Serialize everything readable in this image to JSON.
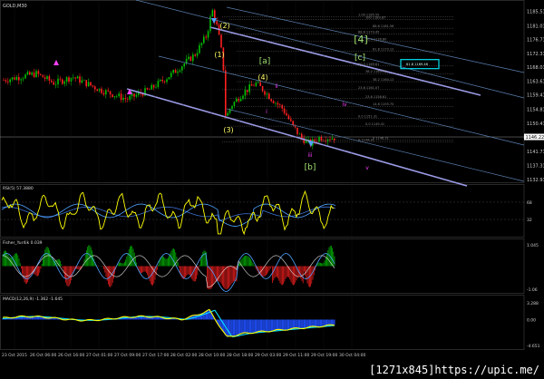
{
  "watermark": "[1271x845]https://upic.me/",
  "colors": {
    "background": "#000000",
    "bull_candle": "#00c000",
    "bear_candle": "#ff2020",
    "channel_main": "#9a9ae6",
    "channel_thin": "#5a7fb0",
    "wave_label": "#ffff66",
    "abc_label": "#a0e070",
    "sub_label": "#ff40ff",
    "rsi_line": "#ffff00",
    "ma_line": "#4fa3ff",
    "fisher_pos": "#00c000",
    "fisher_neg": "#ff2020",
    "macd_hist": "#2050ff",
    "macd_signal": "#00e0ff",
    "grid": "#1e3a1e"
  },
  "main": {
    "title": "GOLD,M30",
    "price_labels": [
      "1185.51",
      "1181.01",
      "1176.71",
      "1172.31",
      "1168.01",
      "1163.61",
      "1159.41",
      "1154.81",
      "1150.41",
      "1146.22",
      "1141.71",
      "1137.31",
      "1132.91"
    ],
    "current_price": "1146.22",
    "wave_labels": [
      "(2)",
      "(1)",
      "(4)",
      "(3)",
      "[a]",
      "[4]",
      "[c]",
      "[b]",
      "i",
      "ii",
      "iii",
      "iv",
      "v"
    ],
    "fib_levels": [
      {
        "label": "1.00 1185.55",
        "y": 1183.8
      },
      {
        "label": "100 1183.87",
        "y": 1183.0
      },
      {
        "label": "88.6 1181.56",
        "y": 1180.2
      },
      {
        "label": "88.6 1179.45",
        "y": 1178.4
      },
      {
        "label": "76.4 1176.80",
        "y": 1176.2
      },
      {
        "label": "61.8 1173.12",
        "y": 1173.0
      },
      {
        "label": "50.0 1169.61",
        "y": 1168.4
      },
      {
        "label": "38.2 1165.98",
        "y": 1166.0
      },
      {
        "label": "38.2 1164.12",
        "y": 1163.5
      },
      {
        "label": "23.6 1161.07",
        "y": 1161.0
      },
      {
        "label": "23.6 1158.61",
        "y": 1158.2
      },
      {
        "label": "14.6 1155.70",
        "y": 1155.8
      },
      {
        "label": "0.0 1151.31",
        "y": 1152.0
      },
      {
        "label": "0.0 1149.41",
        "y": 1149.6
      },
      {
        "label": "0 1146.31",
        "y": 1145.2
      },
      {
        "label": "0 1144.31",
        "y": 1144.6
      }
    ],
    "highlight_level": "61.8 1169.46"
  },
  "time_labels": [
    "23 Oct 2015",
    "26 Oct 06:00",
    "26 Oct 16:00",
    "27 Oct 01:00",
    "27 Oct 09:00",
    "27 Oct 17:00",
    "28 Oct 02:00",
    "28 Oct 10:00",
    "28 Oct 18:00",
    "29 Oct 03:00",
    "29 Oct 11:00",
    "29 Oct 19:00",
    "30 Oct 04:00"
  ],
  "rsi": {
    "title": "RSI(5) 57.3880",
    "levels": [
      "68",
      "32"
    ]
  },
  "fisher": {
    "title": "Fisher_Yur4ik 0.039",
    "levels": [
      "1.045",
      "-1.06"
    ]
  },
  "macd": {
    "title": "MACD(12,26,9) -1.362 -1.645",
    "levels": [
      "3.288",
      "0.00",
      "-4.651"
    ]
  },
  "chart_data": [
    {
      "type": "line",
      "title": "GOLD,M30",
      "note": "price path of candlestick series (approximate closes)",
      "x": [
        "23 Oct 2015",
        "26 Oct 06:00",
        "26 Oct 16:00",
        "27 Oct 01:00",
        "27 Oct 09:00",
        "27 Oct 17:00",
        "28 Oct 02:00",
        "28 Oct 10:00",
        "28 Oct 18:00",
        "29 Oct 03:00",
        "29 Oct 11:00",
        "29 Oct 19:00",
        "30 Oct 04:00"
      ],
      "series": [
        {
          "values": [
            1164,
            1165,
            1164,
            1162,
            1160,
            1163,
            1168,
            1176,
            1184,
            1155,
            1162,
            1147,
            1145
          ]
        }
      ],
      "ylim": [
        1132.9,
        1187.9
      ]
    },
    {
      "type": "line",
      "title": "RSI(5) 57.3880",
      "series": [
        {
          "values": [
            50,
            64,
            41,
            58,
            62,
            45,
            72,
            55,
            70,
            22,
            40,
            35,
            57
          ]
        }
      ],
      "ylim": [
        0,
        100
      ]
    },
    {
      "type": "bar",
      "title": "Fisher_Yur4ik 0.039",
      "series": [
        {
          "values": [
            0.2,
            0.6,
            -0.4,
            0.5,
            0.3,
            -0.2,
            0.7,
            0.4,
            0.8,
            -1.0,
            -0.3,
            -0.5,
            0.04
          ]
        }
      ],
      "ylim": [
        -1.06,
        1.045
      ]
    },
    {
      "type": "area",
      "title": "MACD(12,26,9) -1.362 -1.645",
      "series": [
        {
          "values": [
            0.2,
            0.4,
            0.3,
            0.2,
            0.5,
            0.9,
            1.2,
            1.9,
            2.6,
            -4.2,
            -3.3,
            -2.6,
            -1.36
          ]
        }
      ],
      "ylim": [
        -4.651,
        3.288
      ]
    }
  ]
}
